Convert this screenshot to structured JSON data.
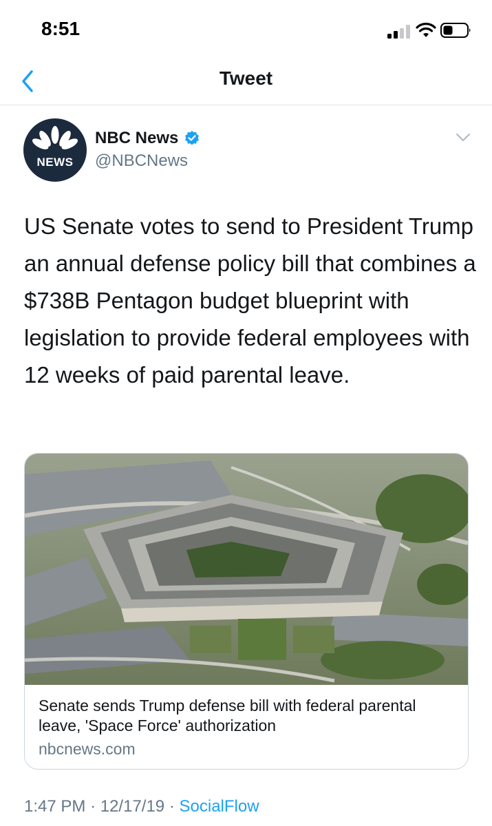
{
  "status_bar": {
    "time": "8:51"
  },
  "nav": {
    "title": "Tweet"
  },
  "tweet": {
    "author_name": "NBC News",
    "author_handle": "@NBCNews",
    "avatar_label": "NEWS",
    "text": "US Senate votes to send to President Trump an annual defense policy bill that combines a $738B Pentagon budget blueprint with legislation to provide federal employees with 12 weeks of paid parental leave.",
    "card": {
      "headline": "Senate sends Trump defense bill with federal parental leave, 'Space Force' authorization",
      "domain": "nbcnews.com"
    },
    "time": "1:47 PM",
    "date": "12/17/19",
    "separator": "·",
    "source": "SocialFlow"
  },
  "colors": {
    "accent": "#1da1f2",
    "secondary_text": "#657786",
    "primary_text": "#14171a",
    "avatar_bg": "#1c2a3e"
  },
  "icons": [
    "back-chevron-icon",
    "signal-icon",
    "wifi-icon",
    "battery-icon",
    "verified-badge-icon",
    "caret-down-icon",
    "nbc-peacock-icon"
  ]
}
